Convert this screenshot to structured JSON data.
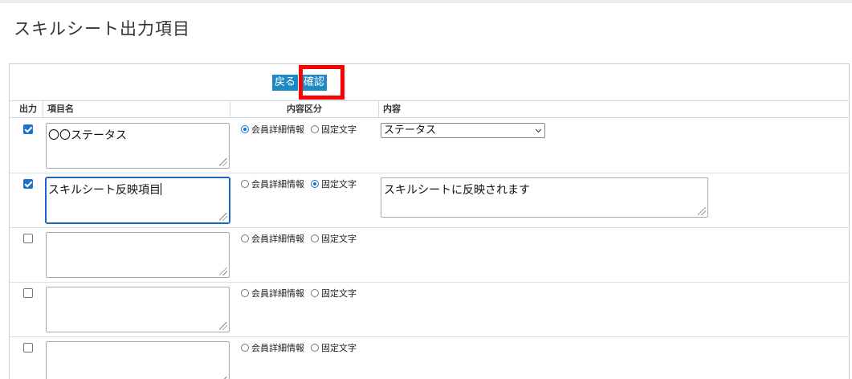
{
  "page": {
    "title": "スキルシート出力項目"
  },
  "toolbar": {
    "back_label": "戻る",
    "confirm_label": "確認"
  },
  "table": {
    "headers": {
      "output": "出力",
      "item_name": "項目名",
      "content_type": "内容区分",
      "content": "内容"
    },
    "radio_labels": {
      "member_detail": "会員詳細情報",
      "fixed_text": "固定文字"
    },
    "rows": [
      {
        "checked": true,
        "name": "〇〇ステータス",
        "mode": "member_detail",
        "content_kind": "select",
        "content": "ステータス"
      },
      {
        "checked": true,
        "name": "スキルシート反映項目",
        "mode": "fixed_text",
        "content_kind": "textarea",
        "content": "スキルシートに反映されます"
      },
      {
        "checked": false,
        "name": "",
        "mode": "",
        "content_kind": "none",
        "content": ""
      },
      {
        "checked": false,
        "name": "",
        "mode": "",
        "content_kind": "none",
        "content": ""
      },
      {
        "checked": false,
        "name": "",
        "mode": "",
        "content_kind": "none",
        "content": ""
      }
    ]
  },
  "colors": {
    "accent": "#1d8ac4",
    "highlight": "#ff0000",
    "border": "#b9d3e4"
  }
}
